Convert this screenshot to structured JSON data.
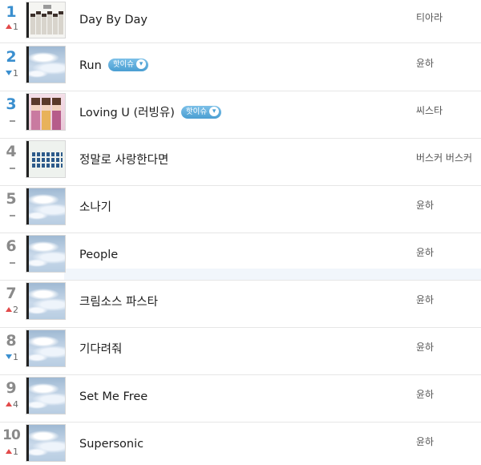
{
  "chart": {
    "rows": [
      {
        "rank": "1",
        "change_dir": "up",
        "change": "1",
        "thumb": "group",
        "title": "Day By Day",
        "badge": "",
        "artist": "티아라"
      },
      {
        "rank": "2",
        "change_dir": "down",
        "change": "1",
        "thumb": "sky",
        "title": "Run",
        "badge": "핫이슈",
        "artist": "윤하"
      },
      {
        "rank": "3",
        "change_dir": "same",
        "change": "",
        "thumb": "trio",
        "title": "Loving U (러빙유)",
        "badge": "핫이슈",
        "artist": "씨스타"
      },
      {
        "rank": "4",
        "change_dir": "same",
        "change": "",
        "thumb": "busker",
        "title": "정말로 사랑한다면",
        "badge": "",
        "artist": "버스커 버스커"
      },
      {
        "rank": "5",
        "change_dir": "same",
        "change": "",
        "thumb": "sky",
        "title": "소나기",
        "badge": "",
        "artist": "윤하"
      },
      {
        "rank": "6",
        "change_dir": "same",
        "change": "",
        "thumb": "sky",
        "title": "People",
        "badge": "",
        "artist": "윤하"
      },
      {
        "rank": "7",
        "change_dir": "up",
        "change": "2",
        "thumb": "sky",
        "title": "크림소스 파스타",
        "badge": "",
        "artist": "윤하"
      },
      {
        "rank": "8",
        "change_dir": "down",
        "change": "1",
        "thumb": "sky",
        "title": "기다려줘",
        "badge": "",
        "artist": "윤하"
      },
      {
        "rank": "9",
        "change_dir": "up",
        "change": "4",
        "thumb": "sky",
        "title": "Set Me Free",
        "badge": "",
        "artist": "윤하"
      },
      {
        "rank": "10",
        "change_dir": "up",
        "change": "1",
        "thumb": "sky",
        "title": "Supersonic",
        "badge": "",
        "artist": "윤하"
      }
    ]
  },
  "colors": {
    "rank_top3": "#3a8fcf",
    "rank_rest": "#8a8a8a",
    "rise": "#e24a4a",
    "fall": "#3a8fcf",
    "badge": "#4a9ed2"
  }
}
